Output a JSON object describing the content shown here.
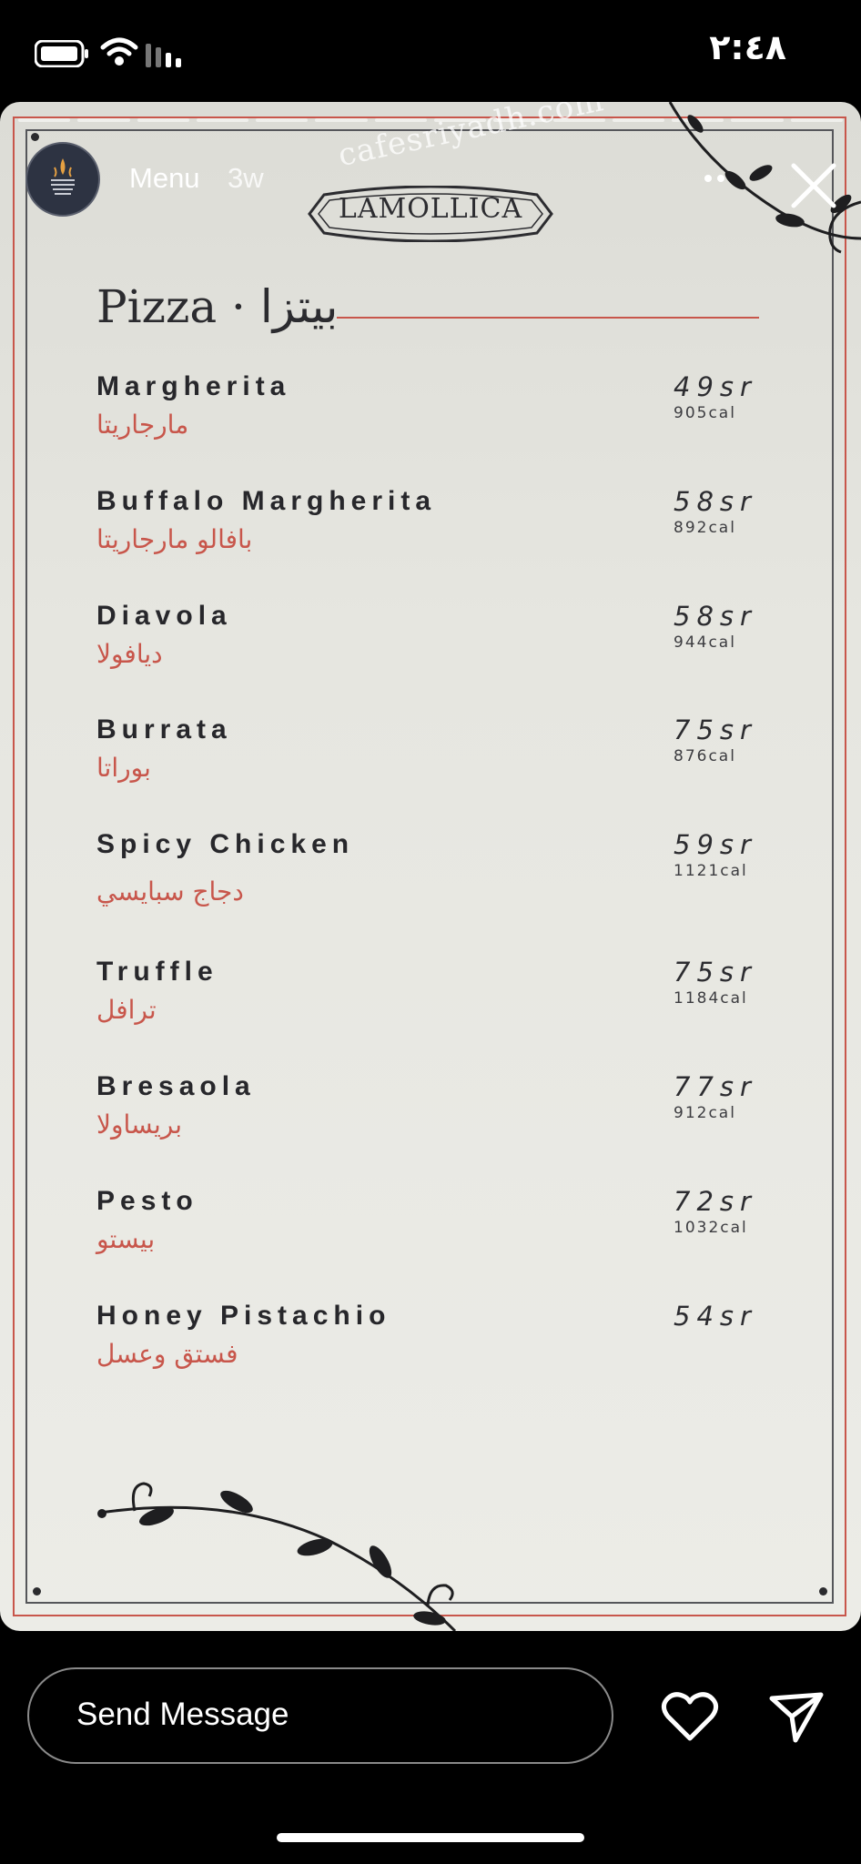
{
  "status_bar": {
    "time": "٢:٤٨",
    "icons": [
      "battery-icon",
      "wifi-icon",
      "signal-icon"
    ]
  },
  "story": {
    "username": "Menu",
    "age": "3w",
    "watermark": "cafesriyadh.com",
    "progress_segments": 14
  },
  "menu": {
    "brand": "LAMOLLICA",
    "section_title": "Pizza · بيتزا",
    "accent_color": "#c8564b",
    "items": [
      {
        "name": "Margherita",
        "arabic": "مارجاريتا",
        "price": "49sr",
        "calories": "905cal"
      },
      {
        "name": "Buffalo Margherita",
        "arabic": "بافالو مارجاريتا",
        "price": "58sr",
        "calories": "892cal"
      },
      {
        "name": "Diavola",
        "arabic": "ديافولا",
        "price": "58sr",
        "calories": "944cal"
      },
      {
        "name": "Burrata",
        "arabic": "بوراتا",
        "price": "75sr",
        "calories": "876cal"
      },
      {
        "name": "Spicy Chicken",
        "arabic": "دجاج سبايسي",
        "price": "59sr",
        "calories": "1121cal"
      },
      {
        "name": "Truffle",
        "arabic": "ترافل",
        "price": "75sr",
        "calories": "1184cal"
      },
      {
        "name": "Bresaola",
        "arabic": "بريساولا",
        "price": "77sr",
        "calories": "912cal"
      },
      {
        "name": "Pesto",
        "arabic": "بيستو",
        "price": "72sr",
        "calories": "1032cal"
      },
      {
        "name": "Honey Pistachio",
        "arabic": "فستق وعسل",
        "price": "54sr",
        "calories": ""
      }
    ]
  },
  "bottom_bar": {
    "message_placeholder": "Send Message"
  }
}
